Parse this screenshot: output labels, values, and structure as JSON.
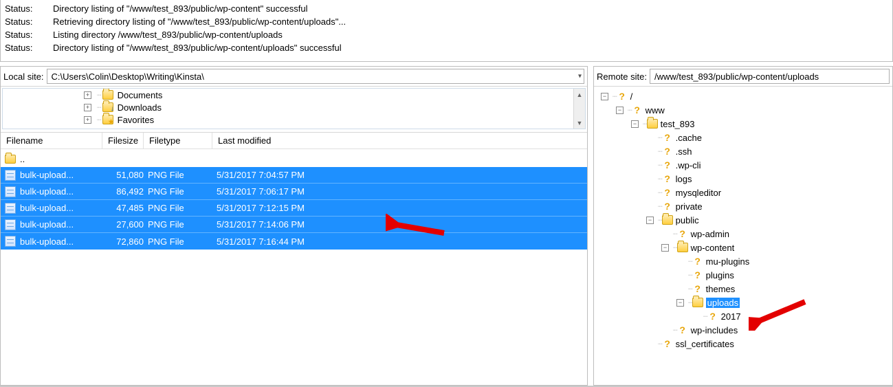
{
  "status_label": "Status:",
  "status_lines": [
    "Directory listing of \"/www/test_893/public/wp-content\" successful",
    "Retrieving directory listing of \"/www/test_893/public/wp-content/uploads\"...",
    "Listing directory /www/test_893/public/wp-content/uploads",
    "Directory listing of \"/www/test_893/public/wp-content/uploads\" successful"
  ],
  "local": {
    "site_label": "Local site:",
    "site_path": "C:\\Users\\Colin\\Desktop\\Writing\\Kinsta\\",
    "tree": [
      {
        "name": "Documents",
        "overlay": ""
      },
      {
        "name": "Downloads",
        "overlay": "down"
      },
      {
        "name": "Favorites",
        "overlay": "star"
      }
    ],
    "headers": {
      "name": "Filename",
      "size": "Filesize",
      "type": "Filetype",
      "mod": "Last modified"
    },
    "parent_row": "..",
    "files": [
      {
        "name": "bulk-upload...",
        "size": "51,080",
        "type": "PNG File",
        "mod": "5/31/2017 7:04:57 PM"
      },
      {
        "name": "bulk-upload...",
        "size": "86,492",
        "type": "PNG File",
        "mod": "5/31/2017 7:06:17 PM"
      },
      {
        "name": "bulk-upload...",
        "size": "47,485",
        "type": "PNG File",
        "mod": "5/31/2017 7:12:15 PM"
      },
      {
        "name": "bulk-upload...",
        "size": "27,600",
        "type": "PNG File",
        "mod": "5/31/2017 7:14:06 PM"
      },
      {
        "name": "bulk-upload...",
        "size": "72,860",
        "type": "PNG File",
        "mod": "5/31/2017 7:16:44 PM"
      }
    ]
  },
  "remote": {
    "site_label": "Remote site:",
    "site_path": "/www/test_893/public/wp-content/uploads",
    "tree": [
      {
        "depth": 0,
        "exp": "minus",
        "icon": "q",
        "name": "/"
      },
      {
        "depth": 1,
        "exp": "minus",
        "icon": "q",
        "name": "www"
      },
      {
        "depth": 2,
        "exp": "minus",
        "icon": "folder",
        "name": "test_893"
      },
      {
        "depth": 3,
        "exp": "none",
        "icon": "q",
        "name": ".cache"
      },
      {
        "depth": 3,
        "exp": "none",
        "icon": "q",
        "name": ".ssh"
      },
      {
        "depth": 3,
        "exp": "none",
        "icon": "q",
        "name": ".wp-cli"
      },
      {
        "depth": 3,
        "exp": "none",
        "icon": "q",
        "name": "logs"
      },
      {
        "depth": 3,
        "exp": "none",
        "icon": "q",
        "name": "mysqleditor"
      },
      {
        "depth": 3,
        "exp": "none",
        "icon": "q",
        "name": "private"
      },
      {
        "depth": 3,
        "exp": "minus",
        "icon": "folder",
        "name": "public"
      },
      {
        "depth": 4,
        "exp": "none",
        "icon": "q",
        "name": "wp-admin"
      },
      {
        "depth": 4,
        "exp": "minus",
        "icon": "folder",
        "name": "wp-content"
      },
      {
        "depth": 5,
        "exp": "none",
        "icon": "q",
        "name": "mu-plugins"
      },
      {
        "depth": 5,
        "exp": "none",
        "icon": "q",
        "name": "plugins"
      },
      {
        "depth": 5,
        "exp": "none",
        "icon": "q",
        "name": "themes"
      },
      {
        "depth": 5,
        "exp": "minus",
        "icon": "folder",
        "name": "uploads",
        "selected": true
      },
      {
        "depth": 6,
        "exp": "none",
        "icon": "q",
        "name": "2017"
      },
      {
        "depth": 4,
        "exp": "none",
        "icon": "q",
        "name": "wp-includes"
      },
      {
        "depth": 3,
        "exp": "none",
        "icon": "q",
        "name": "ssl_certificates"
      }
    ]
  }
}
